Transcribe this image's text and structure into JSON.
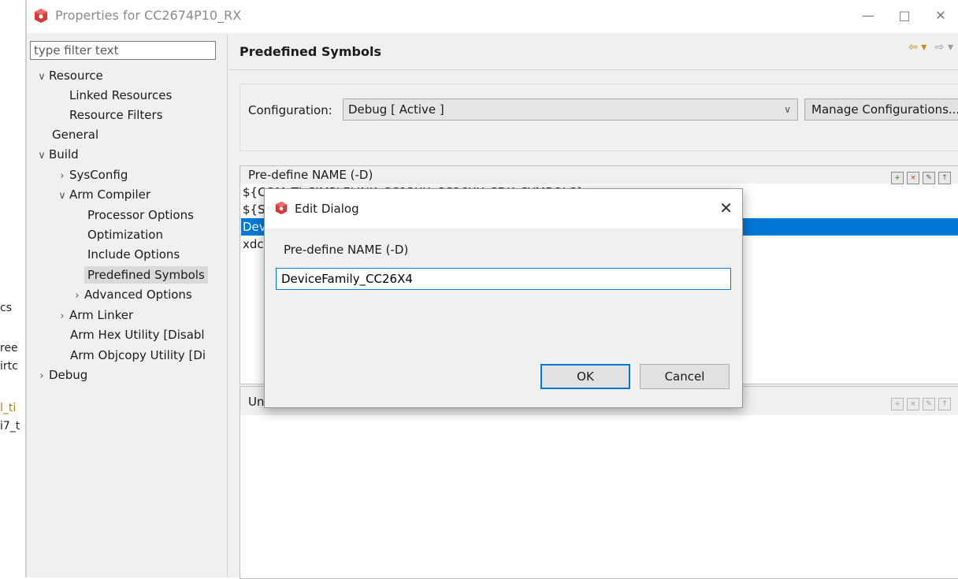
{
  "background_window": {
    "fragments": [
      "cs",
      "ree",
      "irtc",
      "l_ti",
      "i7_t"
    ]
  },
  "window": {
    "title": "Properties for CC2674P10_RX",
    "minimize": "—",
    "maximize": "□",
    "close": "✕"
  },
  "tree": {
    "filter_placeholder": "type filter text",
    "items": [
      {
        "label": "Resource",
        "twisty": "∨"
      },
      {
        "label": "Linked Resources"
      },
      {
        "label": "Resource Filters"
      },
      {
        "label": "General"
      },
      {
        "label": "Build",
        "twisty": "∨"
      },
      {
        "label": "SysConfig",
        "twisty": "›"
      },
      {
        "label": "Arm Compiler",
        "twisty": "∨"
      },
      {
        "label": "Processor Options"
      },
      {
        "label": "Optimization"
      },
      {
        "label": "Include Options"
      },
      {
        "label": "Predefined Symbols",
        "selected": true
      },
      {
        "label": "Advanced Options",
        "twisty": "›"
      },
      {
        "label": "Arm Linker",
        "twisty": "›"
      },
      {
        "label": "Arm Hex Utility  [Disabl"
      },
      {
        "label": "Arm Objcopy Utility  [Di"
      },
      {
        "label": "Debug",
        "twisty": "›"
      }
    ]
  },
  "page": {
    "title": "Predefined Symbols",
    "nav_back": "⇦ ▾",
    "nav_forward": "⇨ ▾",
    "configuration_label": "Configuration:",
    "configuration_value": "Debug  [ Active ]",
    "manage_button": "Manage Configurations..."
  },
  "define_panel": {
    "header": "Pre-define NAME (-D)",
    "rows": [
      {
        "text": "${COM_TI_SIMPLELINK_CC13XX_CC26XX_SDK_SYMBOLS}",
        "selected": false
      },
      {
        "text": "${SY",
        "selected": false
      },
      {
        "text": "Dev",
        "selected": true
      },
      {
        "text": "xdc",
        "selected": false
      }
    ]
  },
  "undefine_panel": {
    "header": "Un"
  },
  "dialog": {
    "title": "Edit Dialog",
    "close": "✕",
    "label": "Pre-define NAME (-D)",
    "value": "DeviceFamily_CC26X4",
    "ok": "OK",
    "cancel": "Cancel"
  },
  "colors": {
    "selection": "#0078d7",
    "window_bg": "#f0f0f0",
    "logo": "#d63a3a"
  }
}
